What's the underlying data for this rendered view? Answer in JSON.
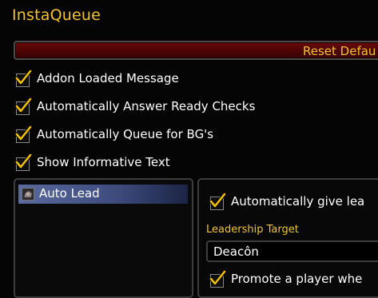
{
  "window": {
    "title": "InstaQueue"
  },
  "reset_button": {
    "label": "Reset Defau"
  },
  "options": [
    {
      "label": "Addon Loaded Message",
      "checked": true
    },
    {
      "label": "Automatically Answer Ready Checks",
      "checked": true
    },
    {
      "label": "Automatically Queue for BG's",
      "checked": true
    },
    {
      "label": "Show Informative Text",
      "checked": true
    }
  ],
  "category_list": {
    "items": [
      {
        "label": "Auto Lead",
        "icon": "module-icon",
        "selected": true
      }
    ]
  },
  "detail": {
    "auto_give_lead": {
      "label": "Automatically give lea",
      "checked": true
    },
    "leadership_target": {
      "label": "Leadership Target",
      "value": "Deacôn"
    },
    "promote_player": {
      "label": "Promote a player whe",
      "checked": true
    }
  },
  "colors": {
    "accent_gold": "#f1c232",
    "button_red": "#5a0606",
    "selection_blue": "#4a5a8e"
  }
}
